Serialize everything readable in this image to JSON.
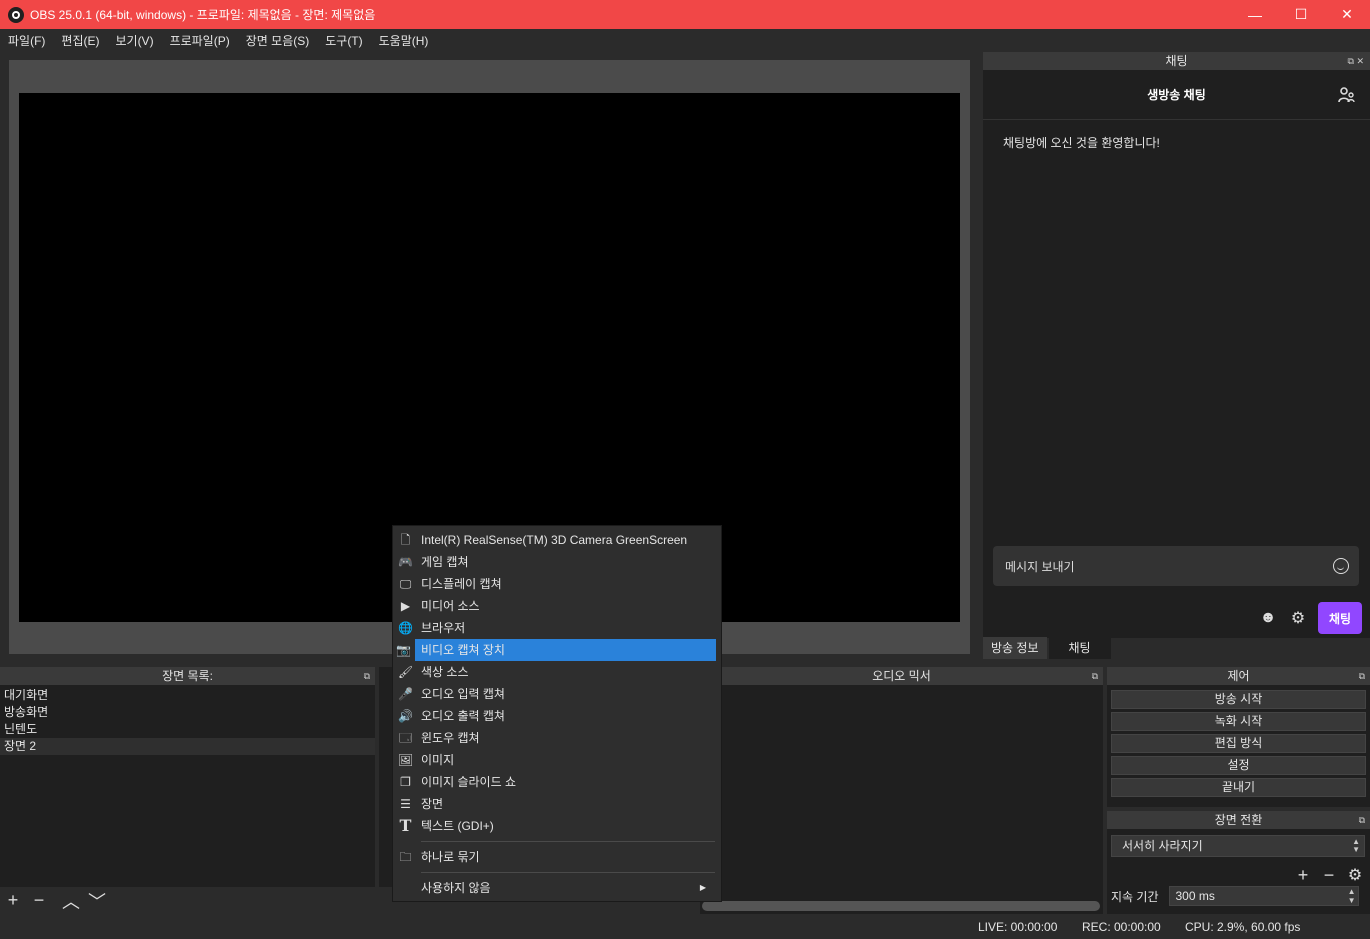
{
  "window": {
    "title": "OBS 25.0.1 (64-bit, windows) - 프로파일: 제목없음 - 장면: 제목없음",
    "minimize_glyph": "—",
    "maximize_glyph": "☐",
    "close_glyph": "✕",
    "titlebar_color": "#f14747"
  },
  "menubar": [
    "파일(F)",
    "편집(E)",
    "보기(V)",
    "프로파일(P)",
    "장면 모음(S)",
    "도구(T)",
    "도움말(H)"
  ],
  "chat": {
    "dock_title": "채팅",
    "header_title": "생방송 채팅",
    "welcome": "채팅방에 오신 것을 환영합니다!",
    "input_placeholder": "메시지 보내기",
    "send_label": "채팅",
    "send_color": "#9147ff"
  },
  "dock_tabs": [
    "방송 정보",
    "채팅"
  ],
  "scenes": {
    "title": "장면 목록:",
    "items": [
      "대기화면",
      "방송화면",
      "닌텐도",
      "장면 2"
    ],
    "selected_index": 3
  },
  "mixer": {
    "title": "오디오 믹서"
  },
  "controls": {
    "title": "제어",
    "buttons": [
      "방송 시작",
      "녹화 시작",
      "편집 방식",
      "설정",
      "끝내기"
    ]
  },
  "transitions": {
    "title": "장면 전환",
    "selected": "서서히 사라지기",
    "duration_label": "지속 기간",
    "duration_value": "300 ms"
  },
  "status": {
    "live": "LIVE: 00:00:00",
    "rec": "REC: 00:00:00",
    "cpu": "CPU: 2.9%, 60.00 fps"
  },
  "context_menu": {
    "items": [
      {
        "label": "Intel(R) RealSense(TM) 3D Camera GreenScreen",
        "icon": "file-icon"
      },
      {
        "label": "게임 캡쳐",
        "icon": "gamepad-icon"
      },
      {
        "label": "디스플레이 캡쳐",
        "icon": "monitor-icon"
      },
      {
        "label": "미디어 소스",
        "icon": "play-icon"
      },
      {
        "label": "브라우저",
        "icon": "globe-icon"
      },
      {
        "label": "비디오 캡쳐 장치",
        "icon": "camera-icon"
      },
      {
        "label": "색상 소스",
        "icon": "brush-icon"
      },
      {
        "label": "오디오 입력 캡쳐",
        "icon": "microphone-icon"
      },
      {
        "label": "오디오 출력 캡쳐",
        "icon": "speaker-icon"
      },
      {
        "label": "윈도우 캡쳐",
        "icon": "window-icon"
      },
      {
        "label": "이미지",
        "icon": "image-icon"
      },
      {
        "label": "이미지 슬라이드 쇼",
        "icon": "slideshow-icon"
      },
      {
        "label": "장면",
        "icon": "list-icon"
      },
      {
        "label": "텍스트 (GDI+)",
        "icon": "text-icon"
      }
    ],
    "group_label": "하나로 묶기",
    "deprecated_label": "사용하지 않음",
    "highlight_color": "#2a82da"
  }
}
